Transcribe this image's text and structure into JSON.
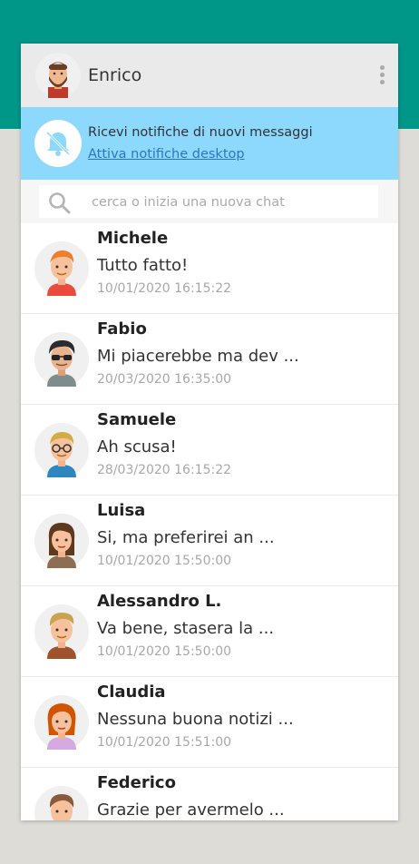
{
  "header": {
    "user_name": "Enrico",
    "menu_icon": "vertical-dots-icon"
  },
  "notification": {
    "icon": "bell-muted-icon",
    "text": "Ricevi notifiche di nuovi messaggi",
    "link": "Attiva notifiche desktop"
  },
  "search": {
    "icon": "search-icon",
    "placeholder": "cerca o inizia una nuova chat"
  },
  "chats": [
    {
      "name": "Michele",
      "message": "Tutto fatto!",
      "time": "10/01/2020 16:15:22"
    },
    {
      "name": "Fabio",
      "message": "Mi piacerebbe ma dev ...",
      "time": "20/03/2020 16:35:00"
    },
    {
      "name": "Samuele",
      "message": "Ah scusa!",
      "time": "28/03/2020 16:15:22"
    },
    {
      "name": "Luisa",
      "message": "Si, ma preferirei an ...",
      "time": "10/01/2020 15:50:00"
    },
    {
      "name": "Alessandro L.",
      "message": "Va bene, stasera la ...",
      "time": "10/01/2020 15:50:00"
    },
    {
      "name": "Claudia",
      "message": "Nessuna buona notizi ...",
      "time": "10/01/2020 15:51:00"
    },
    {
      "name": "Federico",
      "message": "Grazie per avermelo ...",
      "time": ""
    }
  ],
  "colors": {
    "top_band": "#009688",
    "notify_bg": "#8dd8fd",
    "link": "#2a75c8"
  }
}
